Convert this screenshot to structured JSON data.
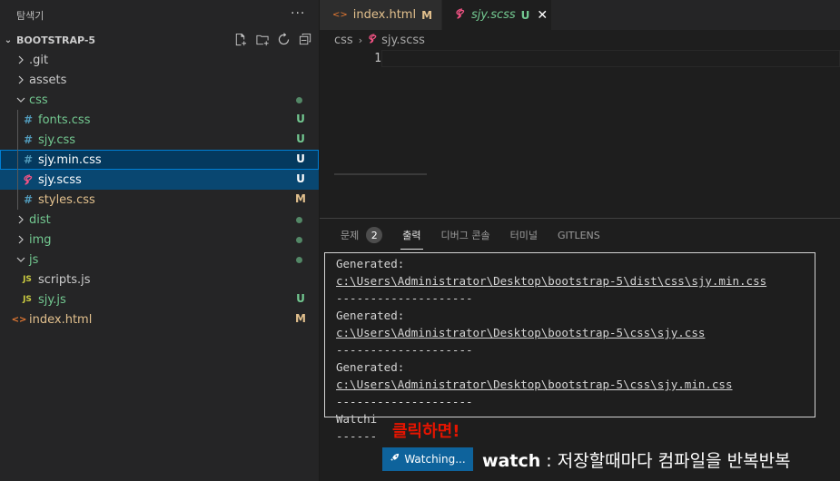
{
  "sidebar": {
    "title": "탐색기",
    "more": "···",
    "section": "BOOTSTRAP-5",
    "items": [
      {
        "label": ".git",
        "chev": "›",
        "depth": 0,
        "status": "",
        "color": "#cccccc"
      },
      {
        "label": "assets",
        "chev": "›",
        "depth": 0,
        "status": "",
        "color": "#cccccc"
      },
      {
        "label": "css",
        "chev": "⌄",
        "depth": 0,
        "status": "dot",
        "color": "#73c991"
      },
      {
        "label": "fonts.css",
        "icon": "#",
        "depth": 1,
        "status": "U",
        "color": "#73c991"
      },
      {
        "label": "sjy.css",
        "icon": "#",
        "depth": 1,
        "status": "U",
        "color": "#73c991"
      },
      {
        "label": "sjy.min.css",
        "icon": "#",
        "depth": 1,
        "status": "U",
        "color": "#ffffff"
      },
      {
        "label": "sjy.scss",
        "icon": "sass",
        "depth": 1,
        "status": "U",
        "color": "#ffffff"
      },
      {
        "label": "styles.css",
        "icon": "#",
        "depth": 1,
        "status": "M",
        "color": "#e2c08d"
      },
      {
        "label": "dist",
        "chev": "›",
        "depth": 0,
        "status": "dot",
        "color": "#73c991"
      },
      {
        "label": "img",
        "chev": "›",
        "depth": 0,
        "status": "dot",
        "color": "#73c991"
      },
      {
        "label": "js",
        "chev": "⌄",
        "depth": 0,
        "status": "dot",
        "color": "#73c991"
      },
      {
        "label": "scripts.js",
        "icon": "JS",
        "depth": 1,
        "status": "",
        "color": "#cccccc"
      },
      {
        "label": "sjy.js",
        "icon": "JS",
        "depth": 1,
        "status": "U",
        "color": "#73c991"
      },
      {
        "label": "index.html",
        "icon": "<>",
        "depth": 0,
        "status": "M",
        "color": "#e2c08d"
      }
    ]
  },
  "tabs": [
    {
      "label": "index.html",
      "mark": "M"
    },
    {
      "label": "sjy.scss",
      "mark": "U",
      "close": "✕"
    }
  ],
  "breadcrumb": {
    "folder": "css",
    "file": "sjy.scss"
  },
  "editor": {
    "line_number": "1"
  },
  "panel": {
    "tabs": [
      "문제",
      "출력",
      "디버그 콘솔",
      "터미널",
      "GITLENS"
    ],
    "problems_count": "2",
    "output": [
      "Generated:",
      "c:\\Users\\Administrator\\Desktop\\bootstrap-5\\dist\\css\\sjy.min.css",
      "--------------------",
      "Generated:",
      "c:\\Users\\Administrator\\Desktop\\bootstrap-5\\css\\sjy.css",
      "--------------------",
      "Generated:",
      "c:\\Users\\Administrator\\Desktop\\bootstrap-5\\css\\sjy.min.css",
      "--------------------"
    ],
    "output_tail": [
      "Watchi",
      "------"
    ]
  },
  "annotations": {
    "click_note": "클릭하면!",
    "watching_label": "Watching...",
    "watch_word": "watch",
    "watch_desc": " : 저장할때마다 컴파일을 반복반복"
  }
}
